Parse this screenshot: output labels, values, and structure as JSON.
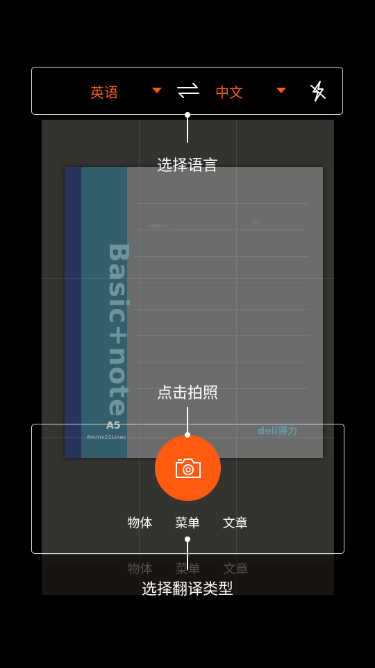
{
  "language_bar": {
    "source_language": "英语",
    "target_language": "中文",
    "swap_icon": "swap-arrows-icon",
    "flash_icon": "flash-auto-icon"
  },
  "guides": {
    "select_language": "选择语言",
    "tap_to_shoot": "点击拍照",
    "select_translation_type": "选择翻译类型"
  },
  "modes": [
    {
      "label": "物体"
    },
    {
      "label": "菜单"
    },
    {
      "label": "文章"
    }
  ],
  "ghost_modes": [
    {
      "label": "物体"
    },
    {
      "label": "菜单"
    },
    {
      "label": "文章"
    }
  ],
  "preview": {
    "notebook_title": "Basic+note",
    "notebook_size": "A5",
    "notebook_lines": "8mmx21Lines",
    "notebook_subject": "Subject",
    "notebook_no": "No.",
    "notebook_brand": "deli得力"
  },
  "colors": {
    "accent": "#ff5a0f",
    "background": "#000000"
  }
}
